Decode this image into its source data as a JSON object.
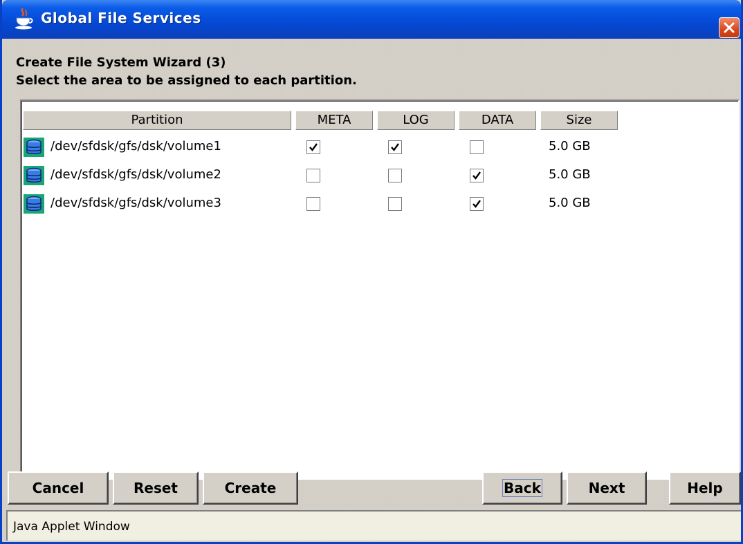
{
  "window": {
    "title": "Global File Services",
    "title_icon": "java-cup-icon",
    "close_icon": "close-icon"
  },
  "wizard": {
    "heading": "Create File System Wizard (3)",
    "instruction": "Select the area to be assigned to each partition."
  },
  "table": {
    "columns": [
      "Partition",
      "META",
      "LOG",
      "DATA",
      "Size"
    ],
    "row_icon": "disk-volume-icon",
    "rows": [
      {
        "partition": "/dev/sfdsk/gfs/dsk/volume1",
        "meta": true,
        "log": true,
        "data": false,
        "size": "5.0 GB"
      },
      {
        "partition": "/dev/sfdsk/gfs/dsk/volume2",
        "meta": false,
        "log": false,
        "data": true,
        "size": "5.0 GB"
      },
      {
        "partition": "/dev/sfdsk/gfs/dsk/volume3",
        "meta": false,
        "log": false,
        "data": true,
        "size": "5.0 GB"
      }
    ]
  },
  "buttons": {
    "cancel": "Cancel",
    "reset": "Reset",
    "create": "Create",
    "back": "Back",
    "next": "Next",
    "help": "Help",
    "focused": "back"
  },
  "status": {
    "text": "Java Applet Window"
  },
  "colors": {
    "titlebar": "#0a5ce8",
    "close_button": "#d9461c",
    "panel_bg": "#d4d0c8",
    "table_bg": "#ffffff",
    "status_bg": "#f1efe2"
  }
}
